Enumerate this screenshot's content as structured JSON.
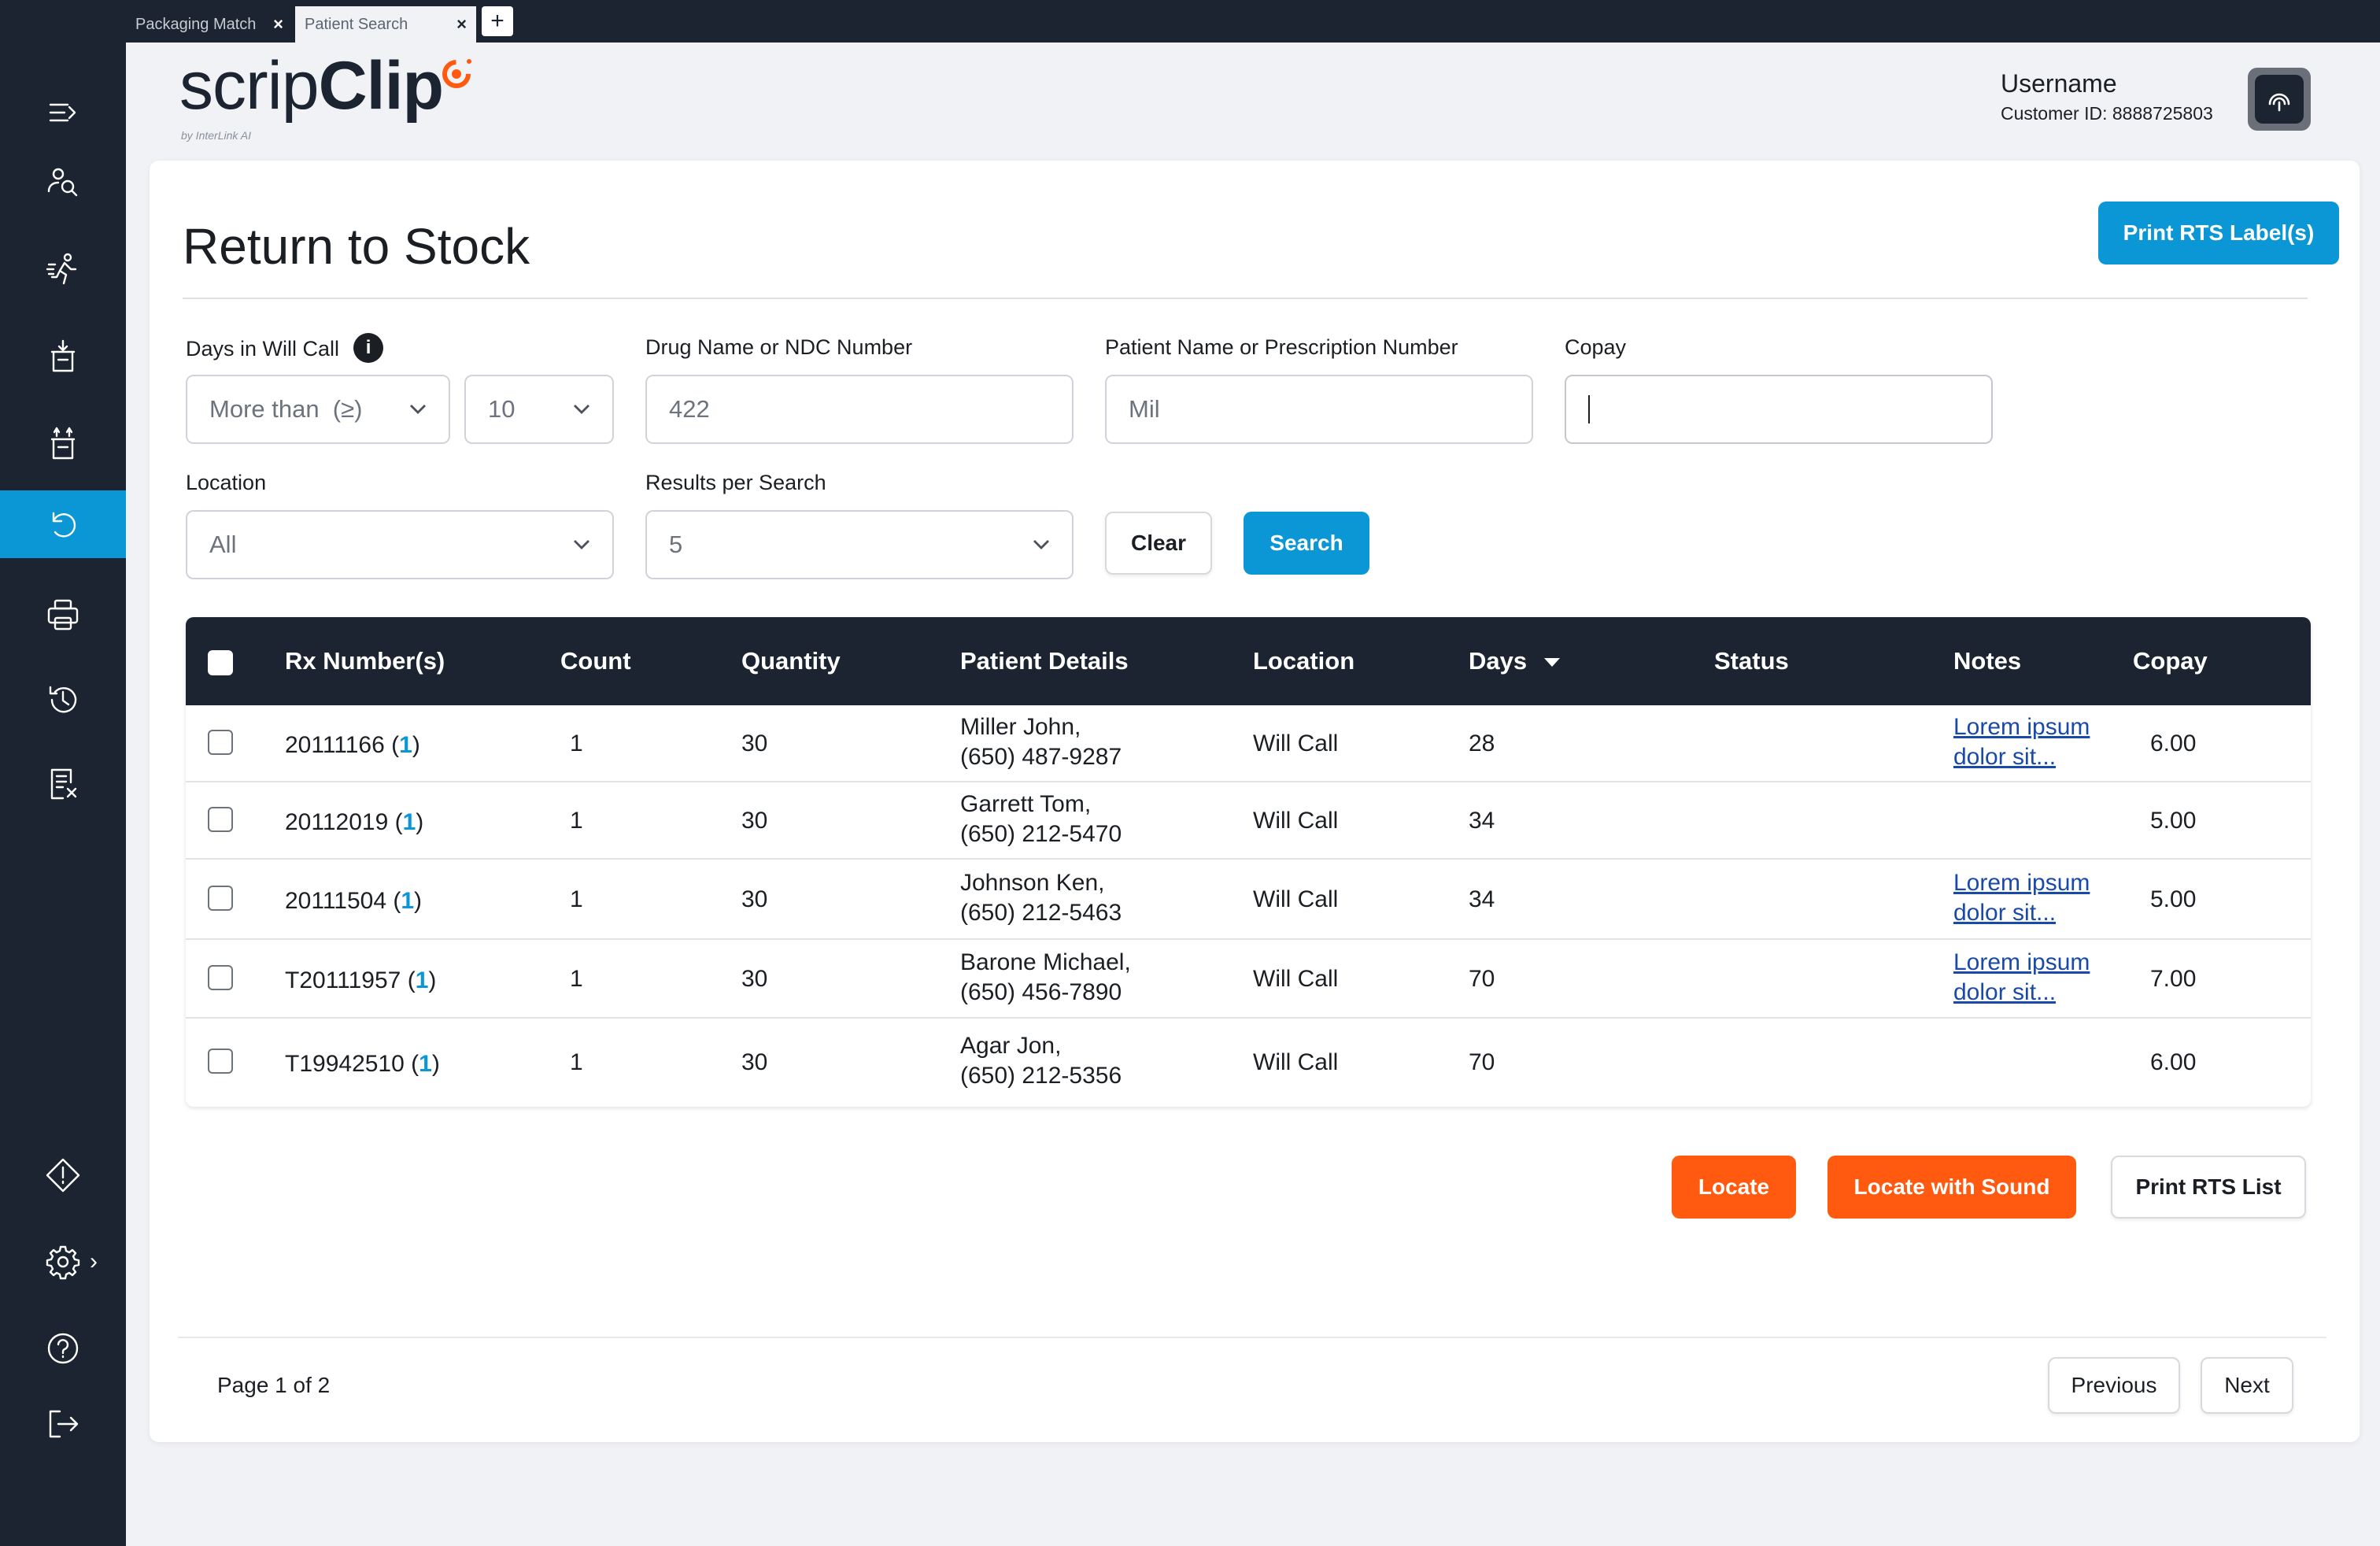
{
  "tabs": [
    {
      "label": "Packaging Match",
      "close": "×"
    },
    {
      "label": "Patient Search",
      "close": "×"
    }
  ],
  "new_tab_label": "+",
  "brand": {
    "name_part1": "scrip",
    "name_part2": "Clip",
    "byline": "by InterLink AI",
    "accent_color": "#ff5a0f"
  },
  "user": {
    "name": "Username",
    "customer_id": "Customer ID: 8888725803"
  },
  "sidebar": {
    "items": [
      {
        "icon": "menu-expand-icon",
        "active": false
      },
      {
        "icon": "patient-search-icon",
        "active": false
      },
      {
        "icon": "runner-icon",
        "active": false
      },
      {
        "icon": "bin-in-icon",
        "active": false
      },
      {
        "icon": "bin-out-icon",
        "active": false
      },
      {
        "icon": "return-to-stock-icon",
        "active": true
      },
      {
        "icon": "printer-icon",
        "active": false
      },
      {
        "icon": "history-icon",
        "active": false
      },
      {
        "icon": "receipt-cancel-icon",
        "active": false
      },
      {
        "icon": "alert-diamond-icon",
        "active": false
      },
      {
        "icon": "settings-gear-icon",
        "active": false
      },
      {
        "icon": "help-icon",
        "active": false
      },
      {
        "icon": "logout-icon",
        "active": false
      }
    ],
    "settings_expand": "›",
    "active_color": "#0b97d6",
    "background": "#1b2430"
  },
  "page": {
    "title": "Return to Stock",
    "print_labels_button": "Print RTS Label(s)"
  },
  "filters": {
    "days_label": "Days in Will Call",
    "days_info": "i",
    "days_operator": "More than  (≥)",
    "days_value": "10",
    "drug_label": "Drug Name or NDC Number",
    "drug_value": "422",
    "patient_label": "Patient Name or Prescription Number",
    "patient_value": "Mil",
    "copay_label": "Copay",
    "copay_value": "",
    "location_label": "Location",
    "location_value": "All",
    "results_label": "Results per Search",
    "results_value": "5",
    "clear_button": "Clear",
    "search_button": "Search"
  },
  "table": {
    "columns": [
      "Rx Number(s)",
      "Count",
      "Quantity",
      "Patient Details",
      "Location",
      "Days",
      "Status",
      "Notes",
      "Copay"
    ],
    "sorted_column": "Days",
    "sort_direction": "descending",
    "rows": [
      {
        "rx": "20111166",
        "rx_count": "1",
        "count": "1",
        "quantity": "30",
        "patient_name": "Miller John,",
        "patient_phone": "(650) 487-9287",
        "location": "Will Call",
        "days": "28",
        "status": "",
        "notes_line1": "Lorem ipsum",
        "notes_line2": "dolor sit...",
        "copay": "6.00"
      },
      {
        "rx": "20112019",
        "rx_count": "1",
        "count": "1",
        "quantity": "30",
        "patient_name": "Garrett Tom,",
        "patient_phone": "(650) 212-5470",
        "location": "Will Call",
        "days": "34",
        "status": "",
        "notes_line1": "",
        "notes_line2": "",
        "copay": "5.00"
      },
      {
        "rx": "20111504",
        "rx_count": "1",
        "count": "1",
        "quantity": "30",
        "patient_name": "Johnson Ken,",
        "patient_phone": "(650) 212-5463",
        "location": "Will Call",
        "days": "34",
        "status": "",
        "notes_line1": "Lorem ipsum",
        "notes_line2": "dolor sit...",
        "copay": "5.00"
      },
      {
        "rx": "T20111957",
        "rx_count": "1",
        "count": "1",
        "quantity": "30",
        "patient_name": "Barone Michael,",
        "patient_phone": "(650) 456-7890",
        "location": "Will Call",
        "days": "70",
        "status": "",
        "notes_line1": "Lorem ipsum",
        "notes_line2": "dolor sit...",
        "copay": "7.00"
      },
      {
        "rx": "T19942510",
        "rx_count": "1",
        "count": "1",
        "quantity": "30",
        "patient_name": "Agar Jon,",
        "patient_phone": "(650) 212-5356",
        "location": "Will Call",
        "days": "70",
        "status": "",
        "notes_line1": "",
        "notes_line2": "",
        "copay": "6.00"
      }
    ]
  },
  "actions": {
    "locate": "Locate",
    "locate_sound": "Locate with Sound",
    "print_list": "Print RTS List"
  },
  "pagination": {
    "label": "Page 1 of 2",
    "previous": "Previous",
    "next": "Next"
  }
}
